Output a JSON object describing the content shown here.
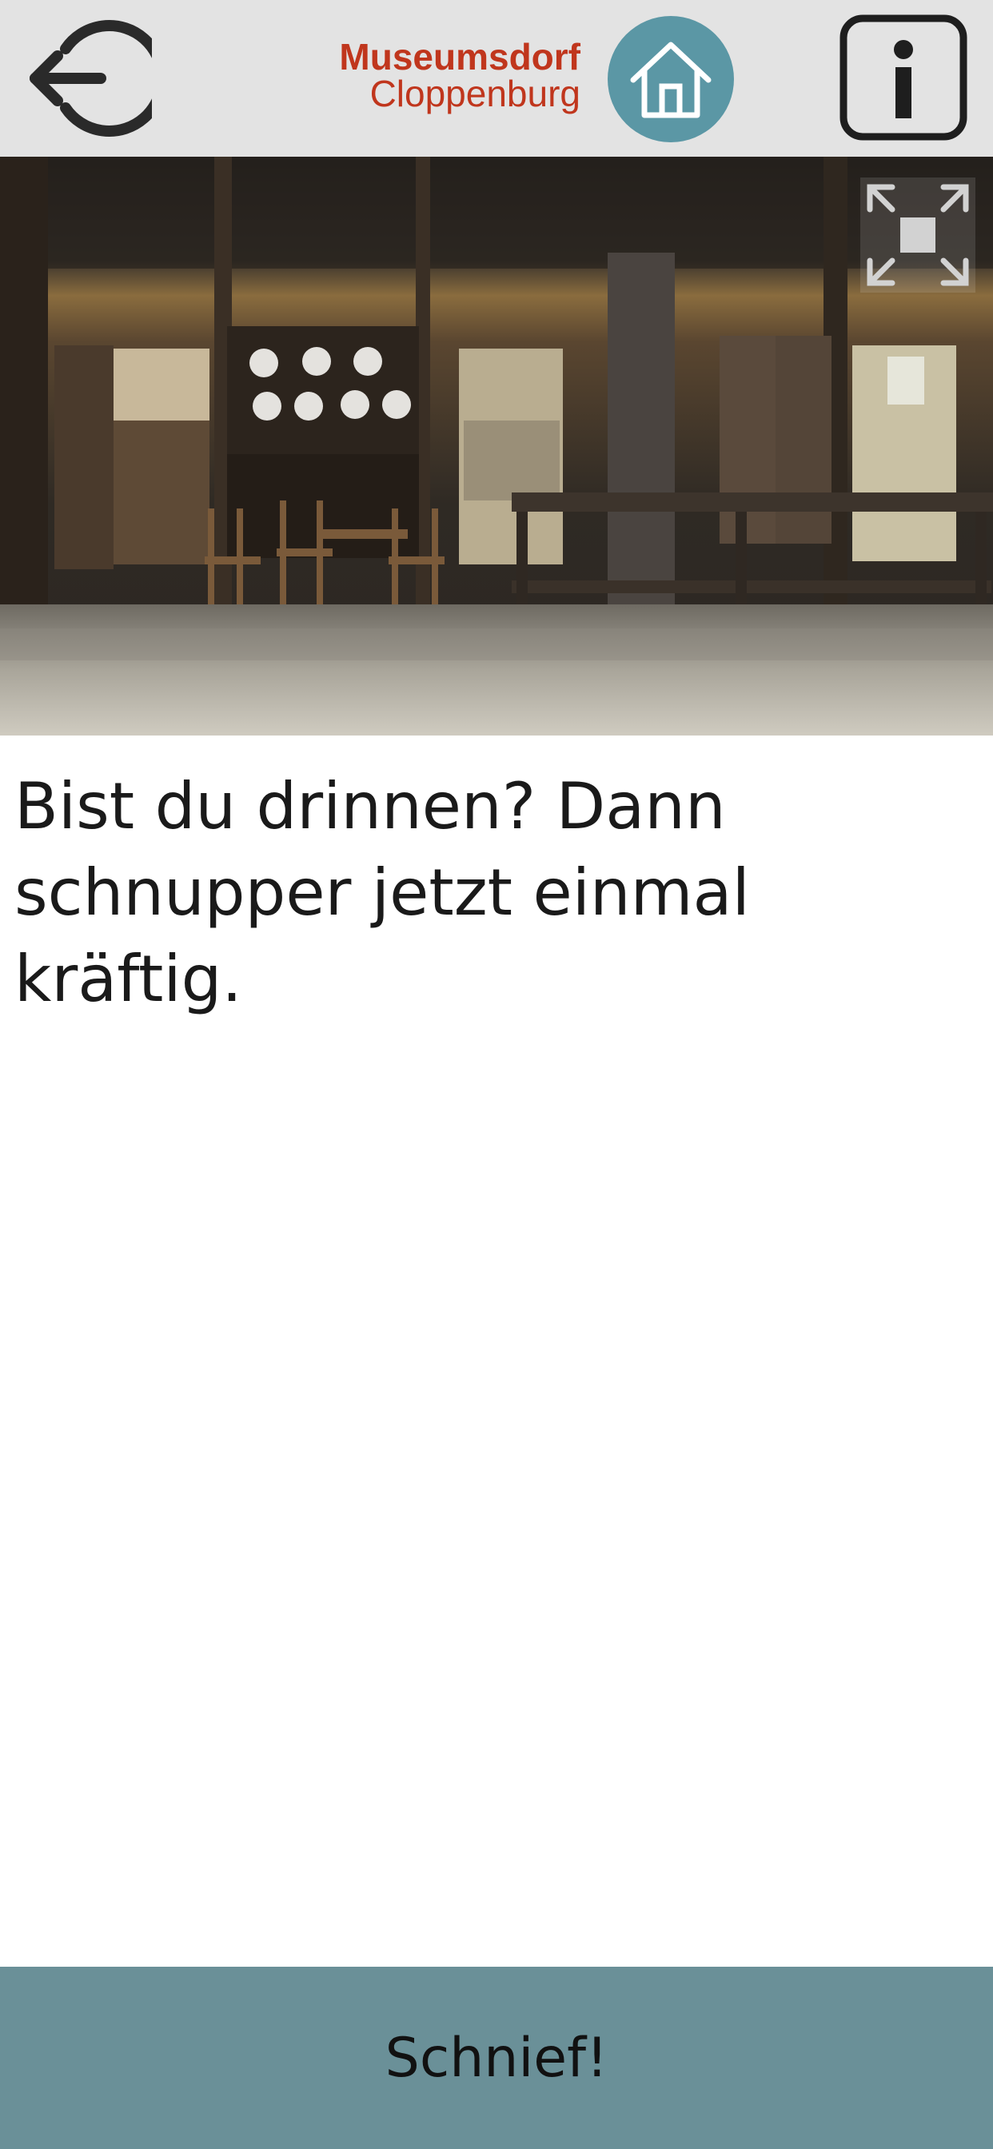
{
  "header": {
    "back_icon": "logout-arrow-icon",
    "brand_line1": "Museumsdorf",
    "brand_line2": "Cloppenburg",
    "home_icon": "home-icon",
    "info_icon": "info-icon",
    "colors": {
      "bar": "#e3e3e3",
      "brand": "#c0361d",
      "home_circle": "#5b97a5"
    }
  },
  "hero": {
    "image": "farmhouse-interior-photo",
    "fullscreen_icon": "fullscreen-icon"
  },
  "content": {
    "prompt": "Bist du drinnen? Dann schnupper jetzt einmal kräftig."
  },
  "action": {
    "label": "Schnief!",
    "color": "#6a9098"
  }
}
